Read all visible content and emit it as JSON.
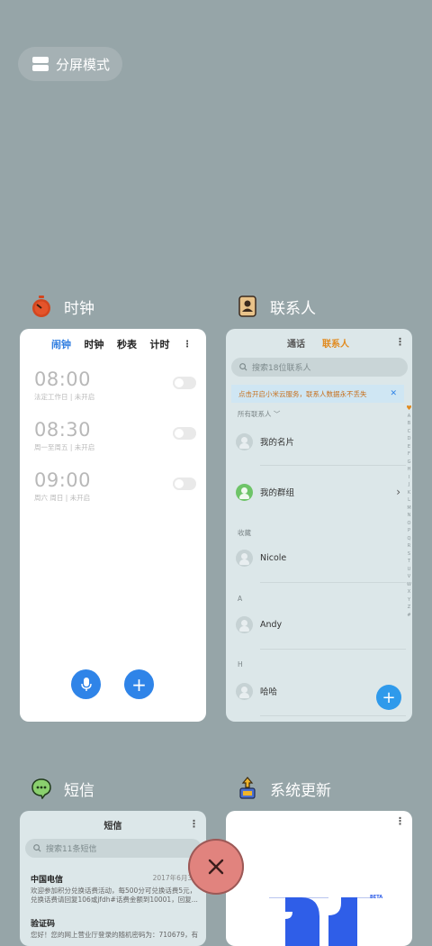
{
  "split_screen": {
    "label": "分屏模式"
  },
  "apps": {
    "clock": {
      "title": "时钟",
      "tabs": [
        "闹钟",
        "时钟",
        "秒表",
        "计时"
      ],
      "alarms": [
        {
          "time": "08:00",
          "sub": "法定工作日 | 未开启",
          "enabled": false
        },
        {
          "time": "08:30",
          "sub": "周一至周五 | 未开启",
          "enabled": false
        },
        {
          "time": "09:00",
          "sub": "周六 周日 | 未开启",
          "enabled": false
        }
      ]
    },
    "contacts": {
      "title": "联系人",
      "tabs": [
        "通话",
        "联系人"
      ],
      "search_placeholder": "搜索18位联系人",
      "banner": "点击开启小米云服务，联系人数据永不丢失",
      "all_label": "所有联系人",
      "rows": [
        {
          "name": "我的名片"
        },
        {
          "name": "我的群组"
        }
      ],
      "sections": [
        {
          "header": "收藏",
          "name": "Nicole"
        },
        {
          "header": "A",
          "name": "Andy"
        },
        {
          "header": "H",
          "name": "哈哈"
        }
      ],
      "alphabet": [
        "♥",
        "A",
        "B",
        "C",
        "D",
        "E",
        "F",
        "G",
        "H",
        "I",
        "J",
        "K",
        "L",
        "M",
        "N",
        "O",
        "P",
        "Q",
        "R",
        "S",
        "T",
        "U",
        "V",
        "W",
        "X",
        "Y",
        "Z",
        "#"
      ]
    },
    "sms": {
      "title": "短信",
      "card_title": "短信",
      "search_placeholder": "搜索11条短信",
      "messages": [
        {
          "name": "中国电信",
          "date": "2017年6月30",
          "text": "欢迎参加积分兑换话费活动，每500分可兑换话费5元，兑换话费请回复106或jfdh#话费金额到10001，回复..."
        },
        {
          "name": "验证码",
          "date": "",
          "text": "您好！您的网上营业厅登录的随机密码为：710679，有"
        }
      ]
    },
    "update": {
      "title": "系统更新",
      "badge": "BETA"
    }
  },
  "colors": {
    "background": "#96a5a8",
    "accent_blue": "#2f84e8",
    "contacts_orange": "#e18a1e",
    "close_button": "#e1837e"
  }
}
